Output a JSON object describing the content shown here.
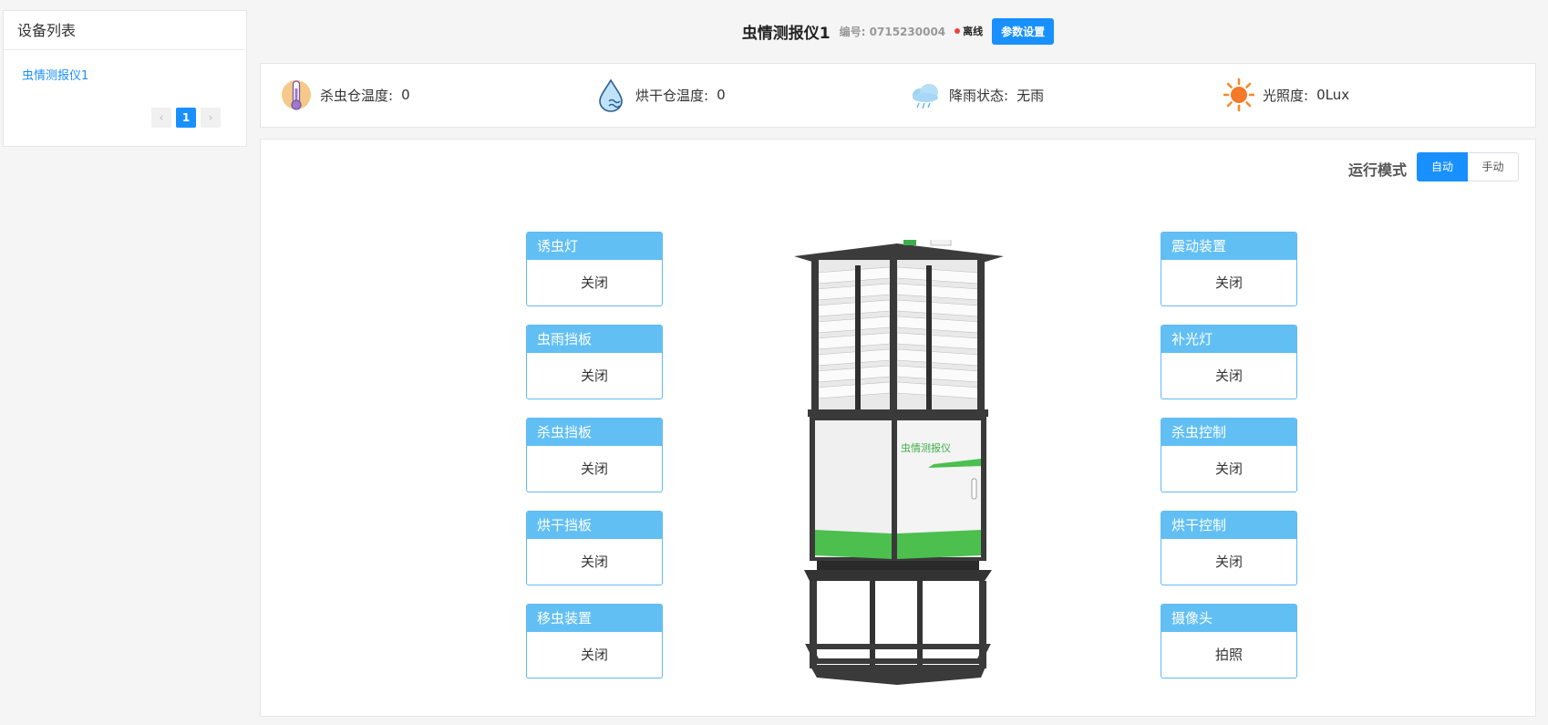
{
  "sidebar": {
    "title": "设备列表",
    "devices": [
      "虫情测报仪1"
    ],
    "pagination": {
      "prev": "‹",
      "current": "1",
      "next": "›"
    }
  },
  "header": {
    "device_name": "虫情测报仪1",
    "code_label": "编号:",
    "code_value": "0715230004",
    "status": "离线",
    "status_color": "#f0443a",
    "settings_button": "参数设置"
  },
  "sensors": [
    {
      "icon": "thermometer-icon",
      "label": "杀虫仓温度:",
      "value": "0"
    },
    {
      "icon": "water-drop-icon",
      "label": "烘干仓温度:",
      "value": "0"
    },
    {
      "icon": "rain-cloud-icon",
      "label": "降雨状态:",
      "value": "无雨"
    },
    {
      "icon": "sun-icon",
      "label": "光照度:",
      "value": "0Lux"
    }
  ],
  "mode": {
    "label": "运行模式",
    "options": [
      "自动",
      "手动"
    ],
    "selected": "自动"
  },
  "device_image": {
    "brand_text": "虫情测报仪"
  },
  "controls_left": [
    {
      "title": "诱虫灯",
      "value": "关闭"
    },
    {
      "title": "虫雨挡板",
      "value": "关闭"
    },
    {
      "title": "杀虫挡板",
      "value": "关闭"
    },
    {
      "title": "烘干挡板",
      "value": "关闭"
    },
    {
      "title": "移虫装置",
      "value": "关闭"
    }
  ],
  "controls_right": [
    {
      "title": "震动装置",
      "value": "关闭"
    },
    {
      "title": "补光灯",
      "value": "关闭"
    },
    {
      "title": "杀虫控制",
      "value": "关闭"
    },
    {
      "title": "烘干控制",
      "value": "关闭"
    },
    {
      "title": "摄像头",
      "value": "拍照"
    }
  ],
  "colors": {
    "accent": "#1890ff",
    "control_header": "#62bff4",
    "device_green": "#4cbf4f"
  }
}
